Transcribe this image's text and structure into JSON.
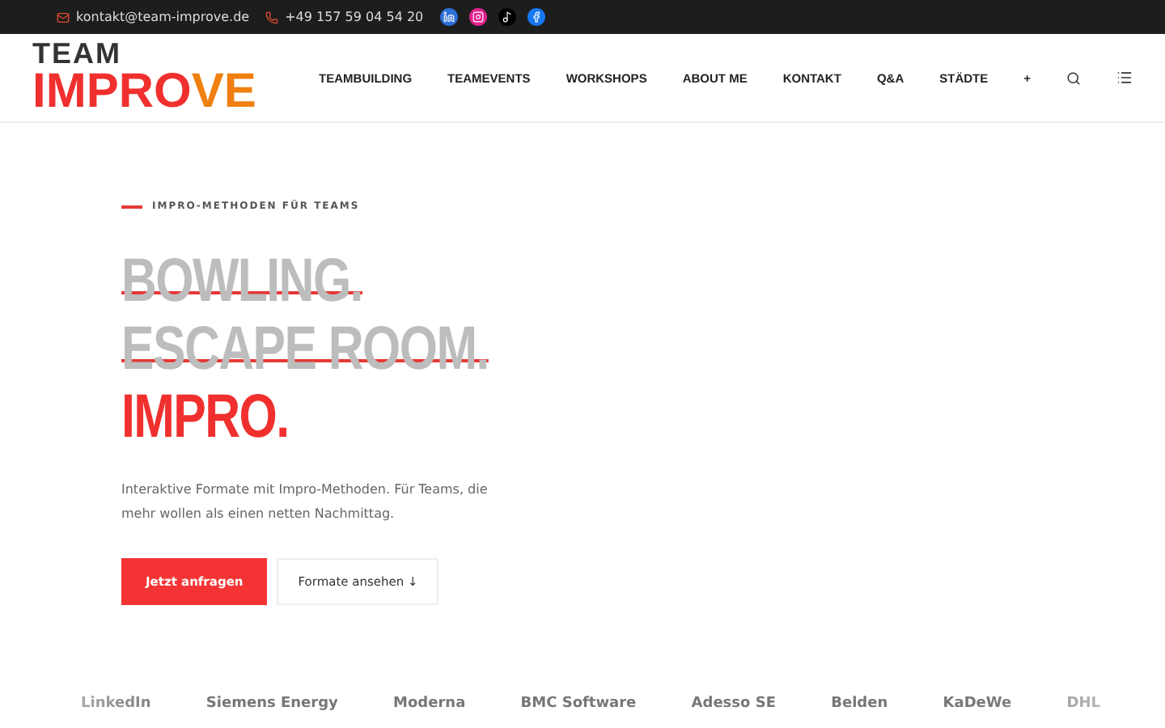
{
  "topbar": {
    "email": "kontakt@team-improve.de",
    "phone": "+49 157 59 04 54 20"
  },
  "logo": {
    "top": "TEAM",
    "main": "IMPRO",
    "accent": "VE"
  },
  "nav": {
    "items": [
      "TEAMBUILDING",
      "TEAMEVENTS",
      "WORKSHOPS",
      "ABOUT ME",
      "KONTAKT",
      "Q&A",
      "STÄDTE",
      "+"
    ]
  },
  "hero": {
    "eyebrow": "IMPRO-METHODEN FÜR TEAMS",
    "lines": [
      {
        "text": "BOWLING.",
        "struck": true
      },
      {
        "text": "ESCAPE ROOM.",
        "struck": true
      },
      {
        "text": "IMPRO.",
        "struck": false
      }
    ],
    "intro": "Interaktive Formate mit Impro-Methoden. Für Teams, die mehr wollen als einen netten Nachmittag.",
    "buttons": [
      {
        "label": "Jetzt anfragen",
        "kind": "primary"
      },
      {
        "label": "Formate ansehen ↓",
        "kind": "secondary"
      }
    ]
  },
  "clients": [
    "LinkedIn",
    "Siemens Energy",
    "Moderna",
    "BMC Software",
    "Adesso SE",
    "Belden",
    "KaDeWe",
    "DHL"
  ]
}
